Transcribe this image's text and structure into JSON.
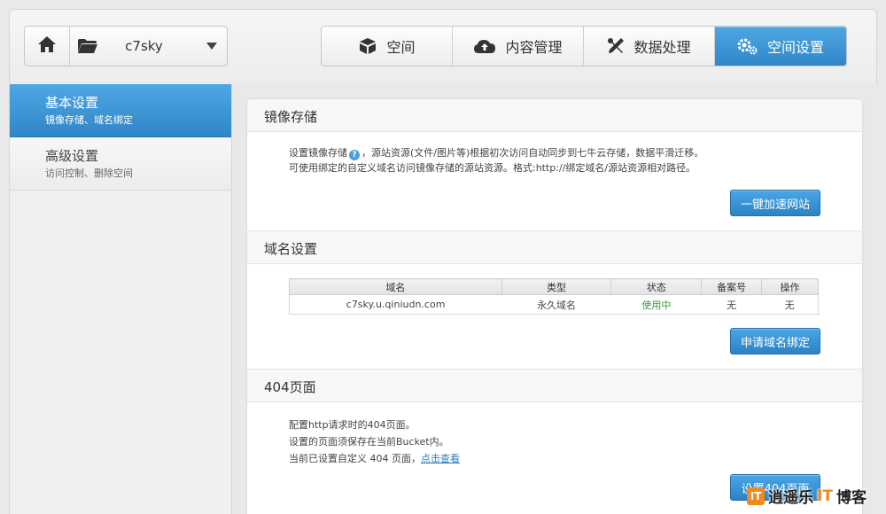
{
  "header": {
    "bucket_name": "c7sky",
    "tabs": [
      {
        "label": "空间",
        "icon": "box-icon",
        "active": false
      },
      {
        "label": "内容管理",
        "icon": "cloud-upload-icon",
        "active": false
      },
      {
        "label": "数据处理",
        "icon": "tools-icon",
        "active": false
      },
      {
        "label": "空间设置",
        "icon": "gears-icon",
        "active": true
      }
    ]
  },
  "sidebar": {
    "items": [
      {
        "title": "基本设置",
        "sub": "镜像存储、域名绑定",
        "active": true
      },
      {
        "title": "高级设置",
        "sub": "访问控制、删除空间",
        "active": false
      }
    ]
  },
  "mirror": {
    "heading": "镜像存储",
    "line1_pre": "设置镜像存储",
    "help": "?",
    "line1_post": "，源站资源(文件/图片等)根据初次访问自动同步到七牛云存储，数据平滑迁移。",
    "line2": "可使用绑定的自定义域名访问镜像存储的源站资源。格式:http://绑定域名/源站资源相对路径。",
    "button": "一键加速网站"
  },
  "domain": {
    "heading": "域名设置",
    "columns": [
      "域名",
      "类型",
      "状态",
      "备案号",
      "操作"
    ],
    "rows": [
      {
        "domain": "c7sky.u.qiniudn.com",
        "type": "永久域名",
        "status": "使用中",
        "icp": "无",
        "action": "无"
      }
    ],
    "button": "申请域名绑定"
  },
  "page404": {
    "heading": "404页面",
    "line1": "配置http请求时的404页面。",
    "line2": "设置的页面须保存在当前Bucket内。",
    "line3_pre": "当前已设置自定义 404 页面，",
    "line3_link": "点击查看",
    "button": "设置404页面"
  },
  "watermark": {
    "logo_text": "IT",
    "text_pre": "逍遥乐",
    "text_accent": "IT",
    "text_post": "博客"
  },
  "colors": {
    "accent": "#3a94d6",
    "status_active": "#3a9a3a",
    "watermark_orange": "#f08a1c"
  }
}
